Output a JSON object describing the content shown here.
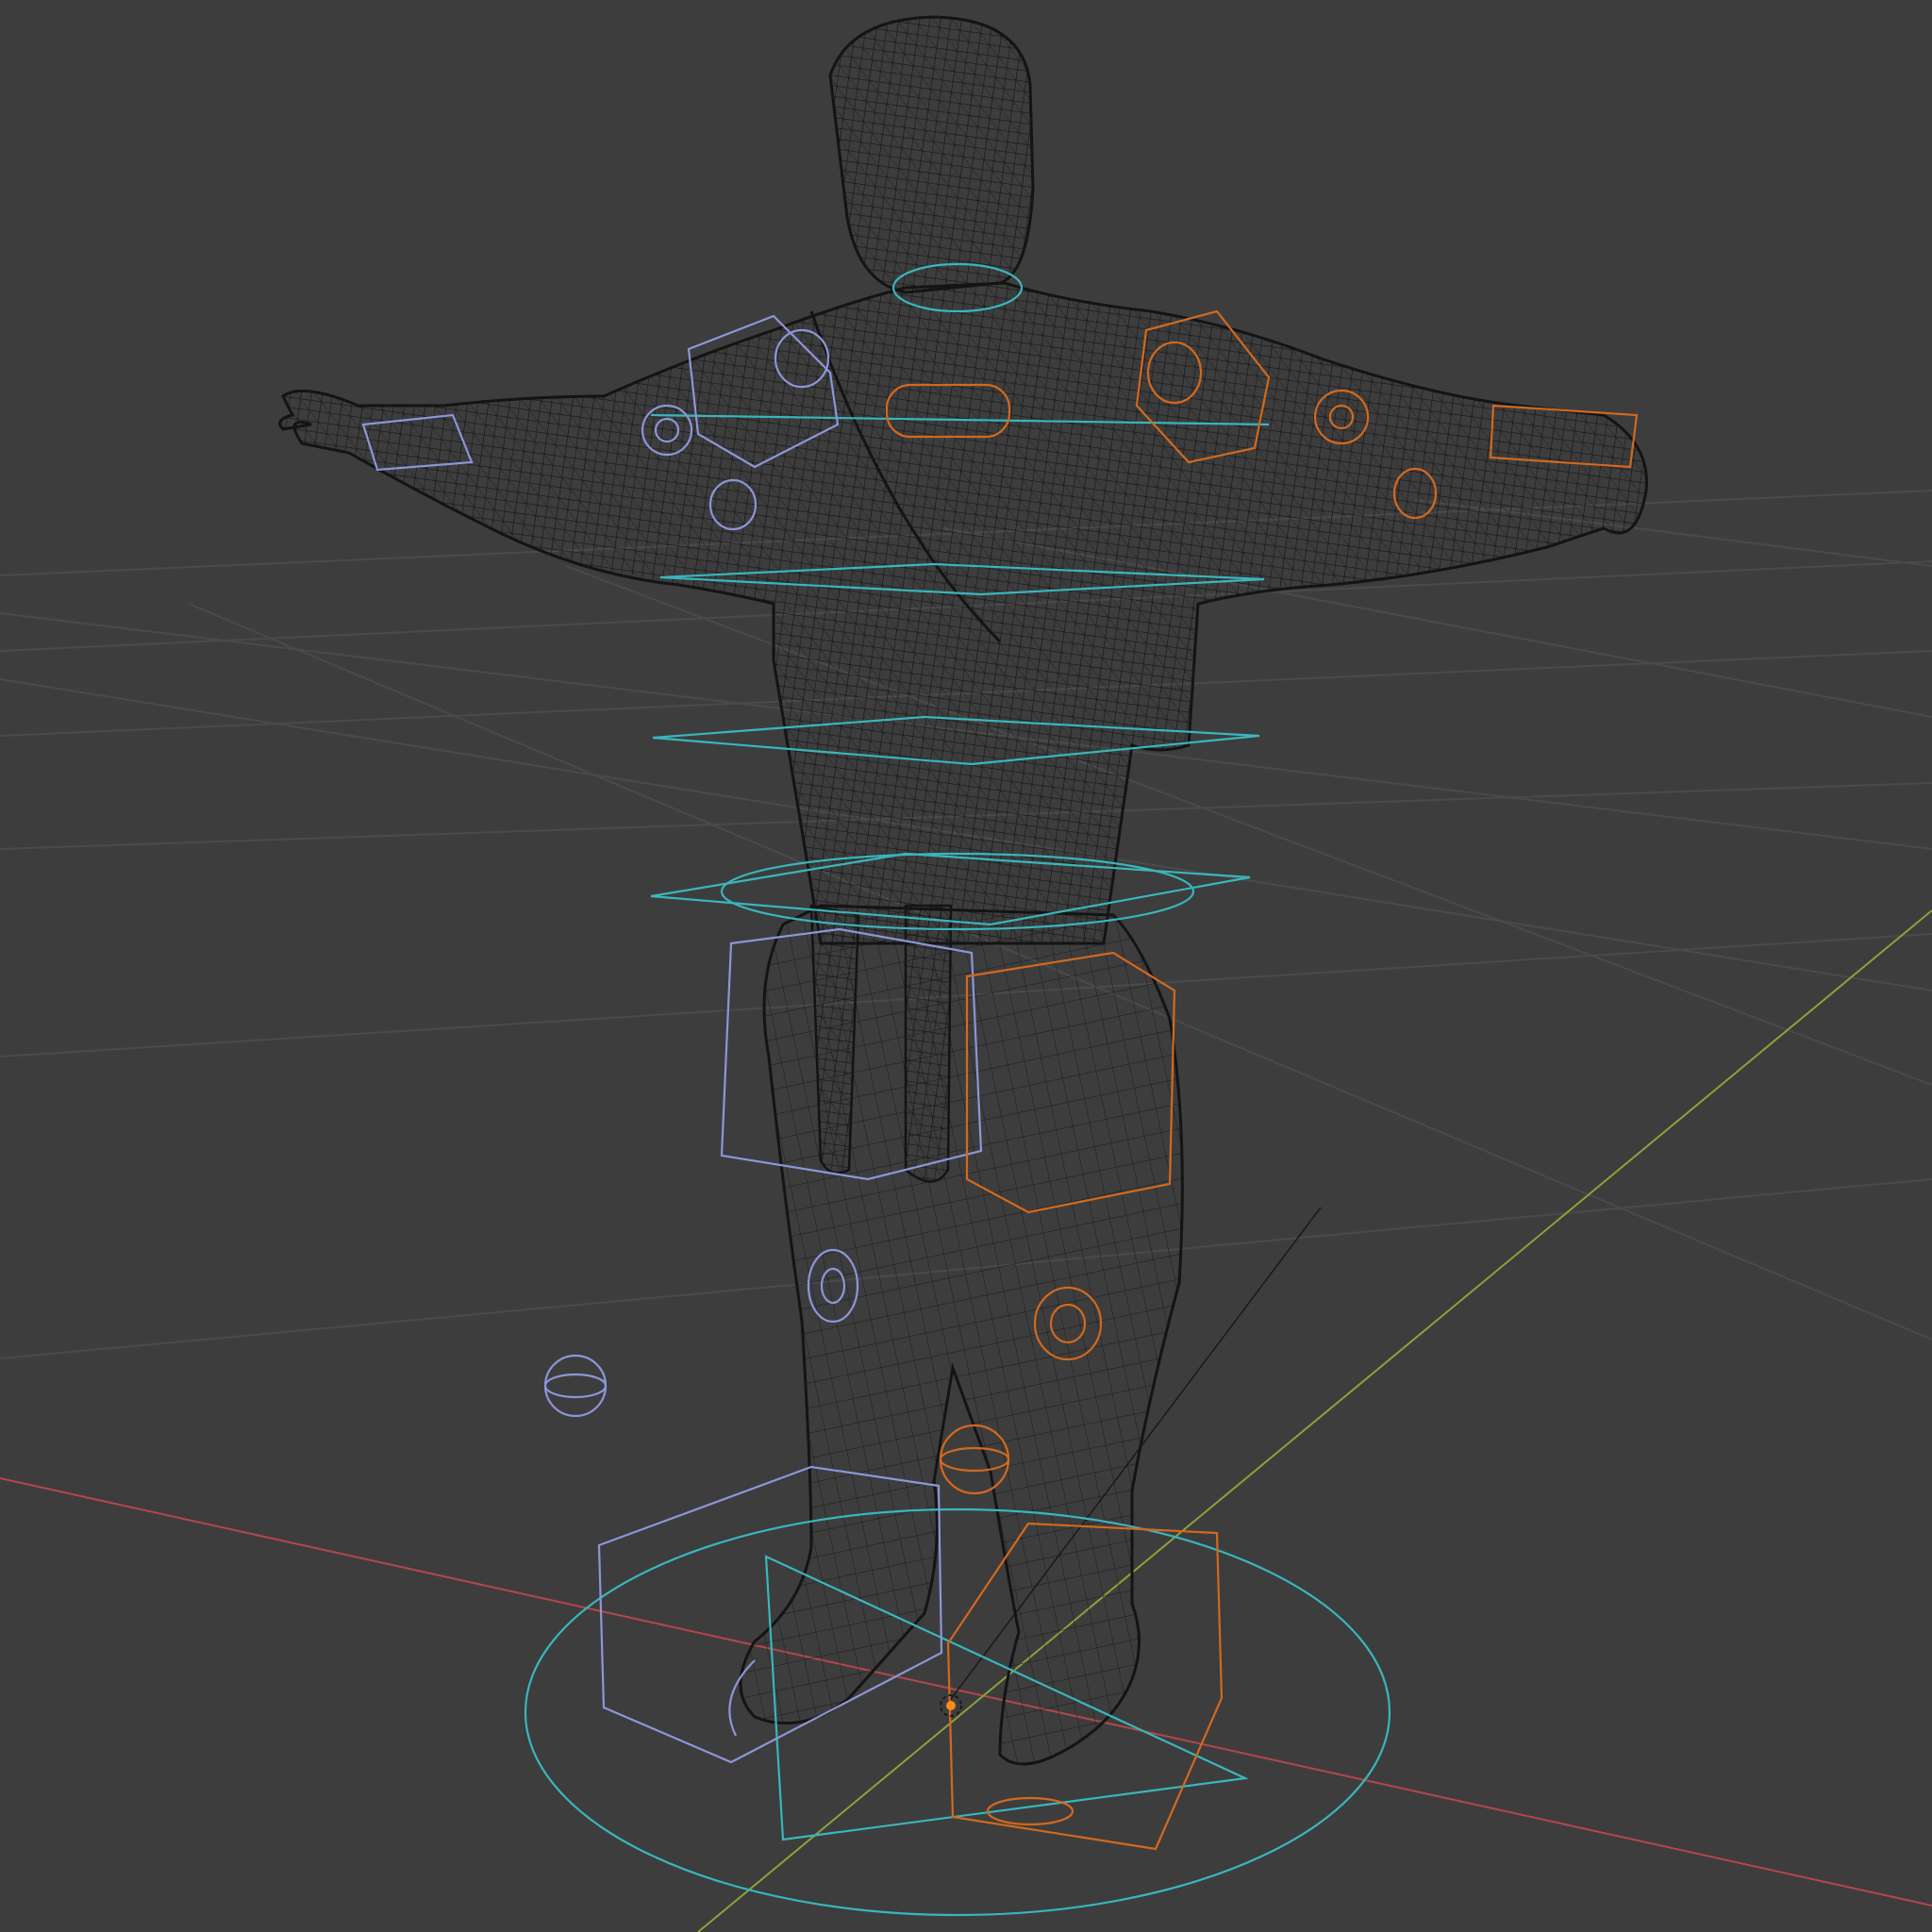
{
  "viewport": {
    "mode": "wireframe",
    "background_color": "#3d3d3d",
    "grid_color": "#4a4a4a",
    "mesh_color": "#141414"
  },
  "axes": {
    "x_color": "#b4474b",
    "y_color": "#8aa23a"
  },
  "rig_colors": {
    "center": "#39b6bd",
    "left": "#8c96d8",
    "right": "#d2691e"
  },
  "object": {
    "type": "armature-with-mesh",
    "pose": "T-pose"
  }
}
